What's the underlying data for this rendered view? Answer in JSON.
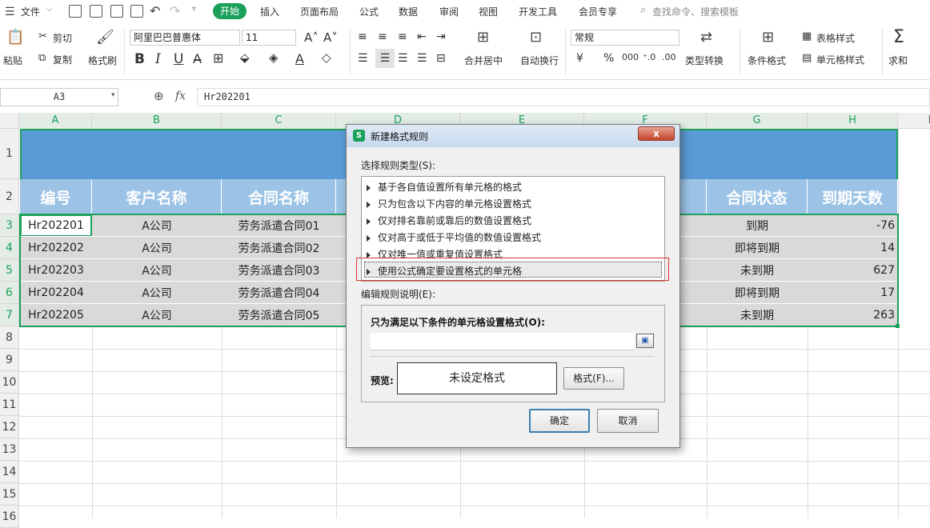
{
  "menu": {
    "file": "文件",
    "tabs": [
      "开始",
      "插入",
      "页面布局",
      "公式",
      "数据",
      "审阅",
      "视图",
      "开发工具",
      "会员专享"
    ],
    "search": "查找命令、搜索模板"
  },
  "ribbon": {
    "paste": "粘贴",
    "cut": "剪切",
    "copy": "复制",
    "format_painter": "格式刷",
    "font_name": "阿里巴巴普惠体",
    "font_size": "11",
    "merge_center": "合并居中",
    "wrap_text": "自动换行",
    "number_format": "常规",
    "type_convert": "类型转换",
    "cond_format": "条件格式",
    "table_style": "表格样式",
    "cell_style": "单元格样式",
    "sum": "求和",
    "bold": "B",
    "italic": "I",
    "underline": "U",
    "currency": "¥",
    "percent": "%"
  },
  "formula": {
    "name_box": "A3",
    "fx": "fx",
    "value": "Hr202201"
  },
  "grid": {
    "columns": [
      "A",
      "B",
      "C",
      "D",
      "E",
      "F",
      "G",
      "H",
      "I"
    ],
    "rows": [
      "1",
      "2",
      "3",
      "4",
      "5",
      "6",
      "7",
      "8",
      "9",
      "10",
      "11",
      "12",
      "13",
      "14",
      "15",
      "16"
    ],
    "headers": {
      "a": "编号",
      "b": "客户名称",
      "c": "合同名称",
      "g": "合同状态",
      "h": "到期天数"
    },
    "data": [
      {
        "a": "Hr202201",
        "b": "A公司",
        "c": "劳务派遣合同01",
        "g": "到期",
        "h": "-76"
      },
      {
        "a": "Hr202202",
        "b": "A公司",
        "c": "劳务派遣合同02",
        "g": "即将到期",
        "h": "14"
      },
      {
        "a": "Hr202203",
        "b": "A公司",
        "c": "劳务派遣合同03",
        "g": "未到期",
        "h": "627"
      },
      {
        "a": "Hr202204",
        "b": "A公司",
        "c": "劳务派遣合同04",
        "g": "即将到期",
        "h": "17"
      },
      {
        "a": "Hr202205",
        "b": "A公司",
        "c": "劳务派遣合同05",
        "g": "未到期",
        "h": "263"
      }
    ]
  },
  "dialog": {
    "title": "新建格式规则",
    "close": "x",
    "select_type_label": "选择规则类型(S):",
    "rule_types": [
      "基于各自值设置所有单元格的格式",
      "只为包含以下内容的单元格设置格式",
      "仅对排名靠前或靠后的数值设置格式",
      "仅对高于或低于平均值的数值设置格式",
      "仅对唯一值或重复值设置格式",
      "使用公式确定要设置格式的单元格"
    ],
    "edit_desc_label": "编辑规则说明(E):",
    "formula_label": "只为满足以下条件的单元格设置格式(O):",
    "formula_value": "",
    "preview_label": "预览:",
    "preview_text": "未设定格式",
    "format_button": "格式(F)...",
    "ok": "确定",
    "cancel": "取消"
  }
}
